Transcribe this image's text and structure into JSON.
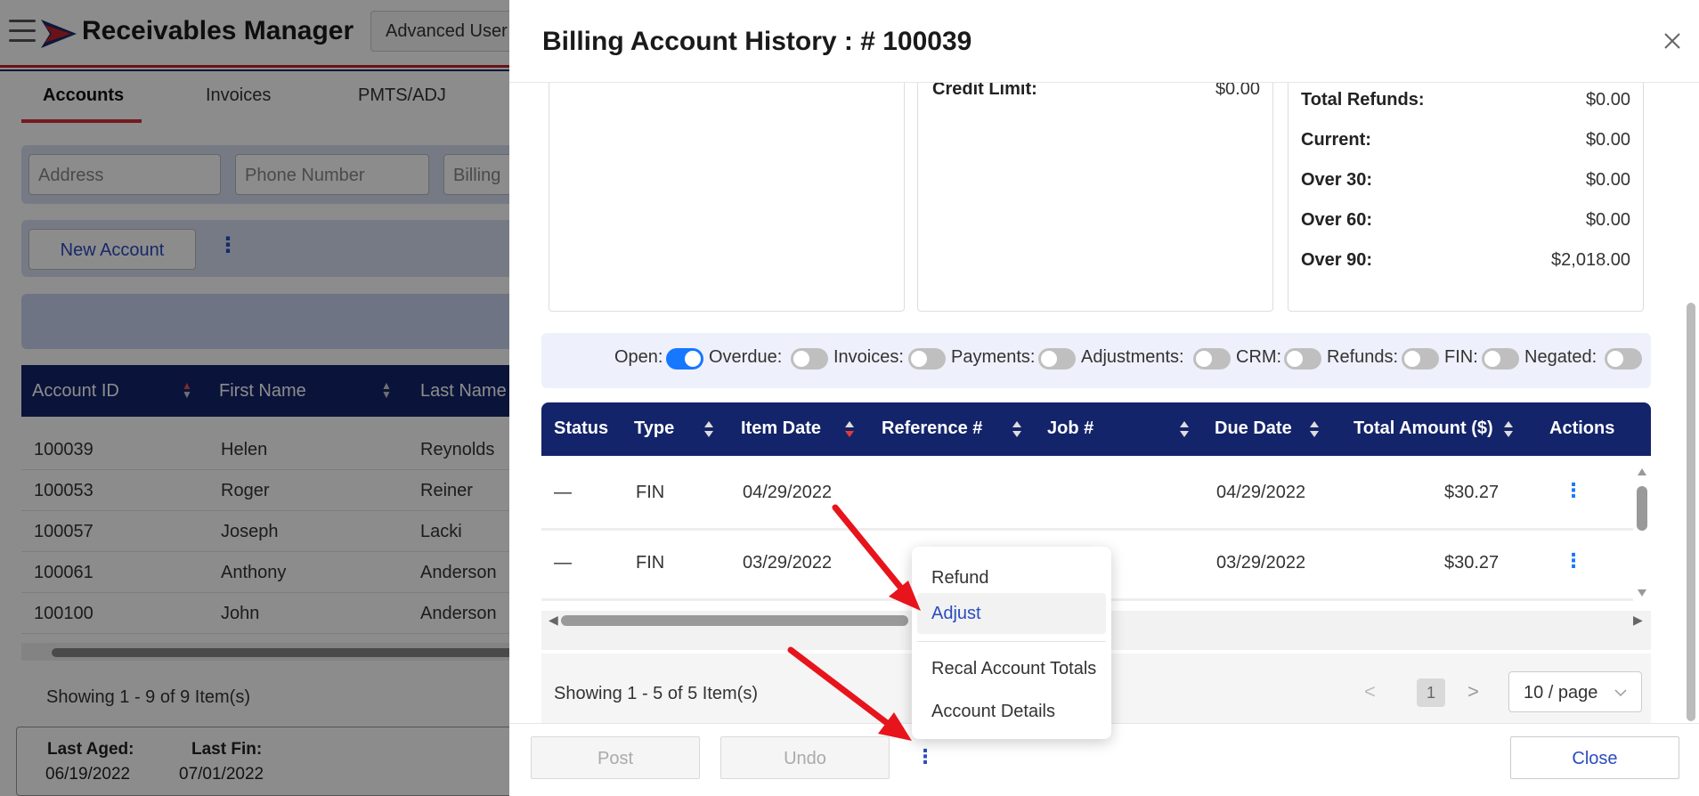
{
  "app": {
    "title": "Receivables Manager",
    "user_button": "Advanced User",
    "tabs": [
      "Accounts",
      "Invoices",
      "PMTS/ADJ"
    ],
    "filters": [
      "Address",
      "Phone Number",
      "Billing"
    ],
    "new_account": "New Account",
    "table_headers": [
      "Account ID",
      "First Name",
      "Last Name"
    ],
    "rows": [
      [
        "100039",
        "Helen",
        "Reynolds"
      ],
      [
        "100053",
        "Roger",
        "Reiner"
      ],
      [
        "100057",
        "Joseph",
        "Lacki"
      ],
      [
        "100061",
        "Anthony",
        "Anderson"
      ],
      [
        "100100",
        "John",
        "Anderson"
      ]
    ],
    "showing": "Showing 1 - 9 of 9 Item(s)",
    "last_aged_label": "Last Aged:",
    "last_aged_value": "06/19/2022",
    "last_fin_label": "Last Fin:",
    "last_fin_value": "07/01/2022"
  },
  "modal": {
    "title": "Billing Account History : # 100039",
    "credit_limit_label": "Credit Limit:",
    "credit_limit_value": "$0.00",
    "summary": [
      {
        "label": "Total Refunds:",
        "value": "$0.00"
      },
      {
        "label": "Current:",
        "value": "$0.00"
      },
      {
        "label": "Over 30:",
        "value": "$0.00"
      },
      {
        "label": "Over 60:",
        "value": "$0.00"
      },
      {
        "label": "Over 90:",
        "value": "$2,018.00"
      }
    ],
    "toggles": [
      {
        "label": "Open:",
        "on": true
      },
      {
        "label": "Overdue:",
        "on": false
      },
      {
        "label": "Invoices:",
        "on": false
      },
      {
        "label": "Payments:",
        "on": false
      },
      {
        "label": "Adjustments:",
        "on": false
      },
      {
        "label": "CRM:",
        "on": false
      },
      {
        "label": "Refunds:",
        "on": false
      },
      {
        "label": "FIN:",
        "on": false
      },
      {
        "label": "Negated:",
        "on": false
      }
    ],
    "columns": [
      "Status",
      "Type",
      "Item Date",
      "Reference #",
      "Job #",
      "Due Date",
      "Total Amount ($)",
      "Actions"
    ],
    "rows": [
      {
        "status": "—",
        "type": "FIN",
        "item_date": "04/29/2022",
        "reference": "",
        "job": "",
        "due_date": "04/29/2022",
        "amount": "$30.27"
      },
      {
        "status": "—",
        "type": "FIN",
        "item_date": "03/29/2022",
        "reference": "",
        "job": "",
        "due_date": "03/29/2022",
        "amount": "$30.27"
      }
    ],
    "showing": "Showing 1 - 5 of 5 Item(s)",
    "page": "1",
    "per_page": "10 / page",
    "post": "Post",
    "undo": "Undo",
    "close": "Close"
  },
  "menu": {
    "items": [
      "Refund",
      "Adjust",
      "Recal Account Totals",
      "Account Details"
    ],
    "highlighted": "Adjust"
  },
  "colors": {
    "navy": "#13246a",
    "brand_red": "#d32f3c",
    "toggle_on": "#1677ff",
    "link": "#2b4bbf",
    "arrow": "#e8141c"
  }
}
